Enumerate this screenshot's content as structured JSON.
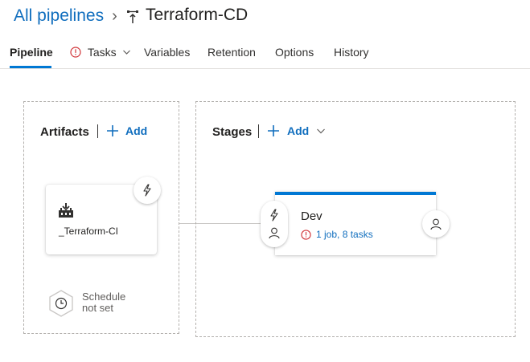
{
  "header": {
    "breadcrumb_label": "All pipelines",
    "breadcrumb_separator": "›",
    "pipeline_title": "Terraform-CD",
    "pipeline_icon": "release-pipeline-icon"
  },
  "tabs": [
    {
      "label": "Pipeline",
      "active": true
    },
    {
      "label": "Tasks",
      "has_warning": true,
      "has_dropdown": true
    },
    {
      "label": "Variables"
    },
    {
      "label": "Retention"
    },
    {
      "label": "Options"
    },
    {
      "label": "History"
    }
  ],
  "artifacts": {
    "title": "Artifacts",
    "add_label": "Add",
    "items": [
      {
        "name": "_Terraform-CI",
        "icon": "build-artifact-icon",
        "trigger_icon": "lightning-icon"
      }
    ],
    "schedule": {
      "line1": "Schedule",
      "line2": "not set",
      "icon": "clock-icon"
    }
  },
  "stages": {
    "title": "Stages",
    "add_label": "Add",
    "items": [
      {
        "name": "Dev",
        "status": "1 job, 8 tasks",
        "status_icon": "warning-icon"
      }
    ]
  },
  "colors": {
    "accent": "#0078d4",
    "link": "#106ebe",
    "warning": "#d13438",
    "border": "#b3b0ad"
  }
}
